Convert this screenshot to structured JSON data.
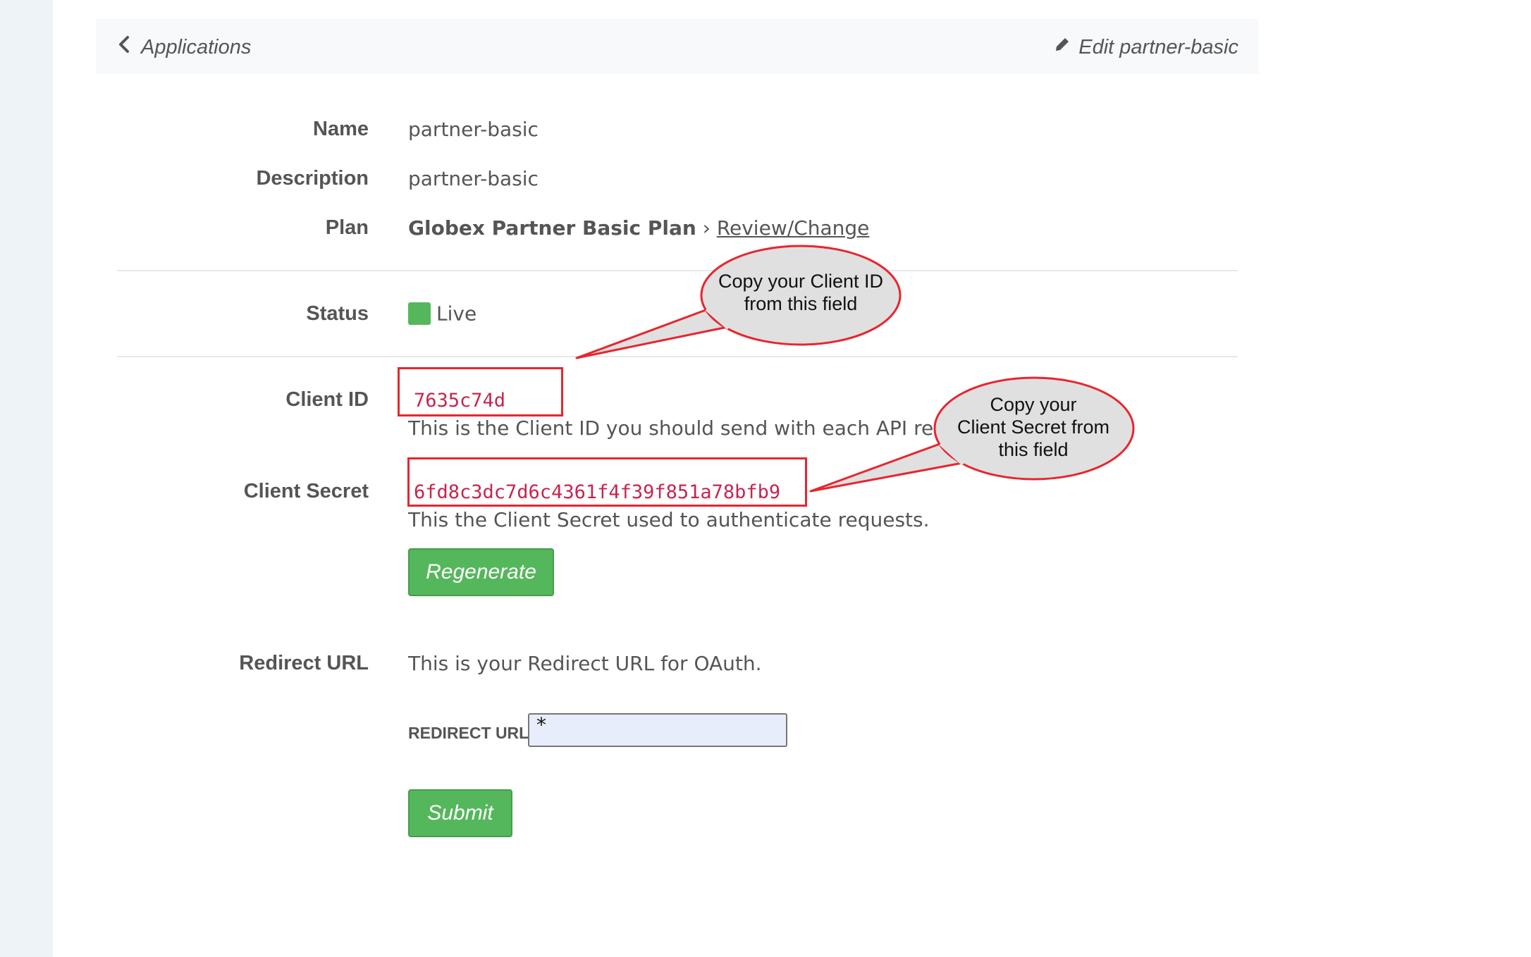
{
  "header": {
    "back_label": "Applications",
    "edit_label": "Edit partner-basic"
  },
  "fields": {
    "name_label": "Name",
    "name_value": "partner-basic",
    "description_label": "Description",
    "description_value": "partner-basic",
    "plan_label": "Plan",
    "plan_value": "Globex Partner Basic Plan",
    "plan_separator": "›",
    "plan_link": "Review/Change",
    "status_label": "Status",
    "status_value": "Live",
    "client_id_label": "Client ID",
    "client_id_value": "7635c74d",
    "client_id_help": "This is the Client ID you should send with each API req",
    "client_secret_label": "Client Secret",
    "client_secret_value": "6fd8c3dc7d6c4361f4f39f851a78bfb9",
    "client_secret_help": "This the Client Secret used to authenticate requests.",
    "regenerate_label": "Regenerate",
    "redirect_url_label": "Redirect URL",
    "redirect_url_help": "This is your Redirect URL for OAuth.",
    "redirect_input_label": "REDIRECT URL",
    "redirect_input_value": "*",
    "submit_label": "Submit"
  },
  "callouts": {
    "client_id_note_line1": "Copy your Client ID",
    "client_id_note_line2": "from this field",
    "client_secret_note_line1": "Copy your",
    "client_secret_note_line2": "Client Secret from",
    "client_secret_note_line3": "this field"
  },
  "colors": {
    "status_live": "#55b75c",
    "button_green": "#55b75c",
    "code_red": "#c7254e",
    "annotation_red": "#e8252e",
    "callout_fill": "#e0e0e0"
  },
  "icons": [
    "chevron-left-icon",
    "pencil-icon"
  ]
}
